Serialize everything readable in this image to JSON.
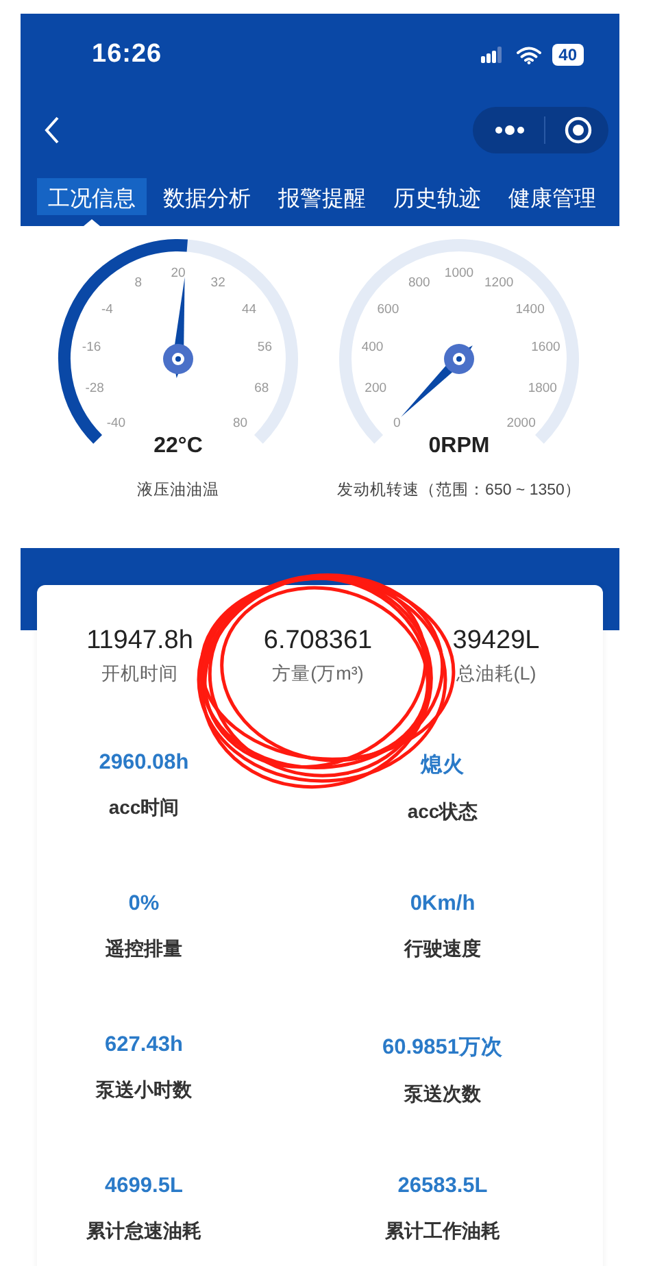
{
  "status_bar": {
    "time": "16:26",
    "battery": "40"
  },
  "tabs": [
    {
      "label": "工况信息",
      "selected": true
    },
    {
      "label": "数据分析",
      "selected": false
    },
    {
      "label": "报警提醒",
      "selected": false
    },
    {
      "label": "历史轨迹",
      "selected": false
    },
    {
      "label": "健康管理",
      "selected": false
    }
  ],
  "gauges": [
    {
      "ticks": [
        "-40",
        "-28",
        "-16",
        "-4",
        "8",
        "20",
        "32",
        "44",
        "56",
        "68",
        "80"
      ],
      "reading": "22°C",
      "label": "液压油油温",
      "level": 0.517
    },
    {
      "ticks": [
        "0",
        "200",
        "400",
        "600",
        "800",
        "1000",
        "1200",
        "1400",
        "1600",
        "1800",
        "2000"
      ],
      "reading": "0RPM",
      "label": "发动机转速（范围：650 ~ 1350）"
    }
  ],
  "summary": [
    {
      "value": "11947.8h",
      "label": "开机时间"
    },
    {
      "value": "6.708361",
      "label": "方量(万m³)"
    },
    {
      "value": "39429L",
      "label": "总油耗(L)"
    }
  ],
  "metrics": [
    {
      "value": "2960.08h",
      "label": "acc时间"
    },
    {
      "value": "熄火",
      "label": "acc状态"
    },
    {
      "value": "0%",
      "label": "遥控排量"
    },
    {
      "value": "0Km/h",
      "label": "行驶速度"
    },
    {
      "value": "627.43h",
      "label": "泵送小时数"
    },
    {
      "value": "60.9851万次",
      "label": "泵送次数"
    },
    {
      "value": "4699.5L",
      "label": "累计怠速油耗"
    },
    {
      "value": "26583.5L",
      "label": "累计工作油耗"
    }
  ]
}
